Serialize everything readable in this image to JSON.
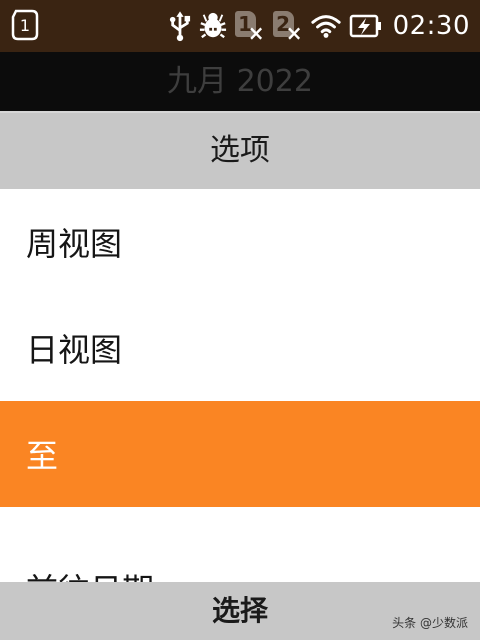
{
  "status_bar": {
    "notification_count": "1",
    "sim_slots": [
      {
        "number": "1",
        "status": "×"
      },
      {
        "number": "2",
        "status": "×"
      }
    ],
    "icons": [
      "usb-icon",
      "bug-icon",
      "sim-1-icon",
      "sim-2-icon",
      "wifi-icon",
      "battery-charging-icon"
    ],
    "time": "02:30",
    "background_color": "#3a2412"
  },
  "calendar_header": {
    "title": "九月 2022"
  },
  "dialog": {
    "title": "选项",
    "items": [
      {
        "label": "周视图",
        "selected": false
      },
      {
        "label": "日视图",
        "selected": false
      },
      {
        "label": "至",
        "selected": true
      },
      {
        "label": "前往日期",
        "selected": false
      }
    ],
    "select_label": "选择",
    "highlight_color": "#fa8523"
  },
  "watermark": "头条 @少数派"
}
